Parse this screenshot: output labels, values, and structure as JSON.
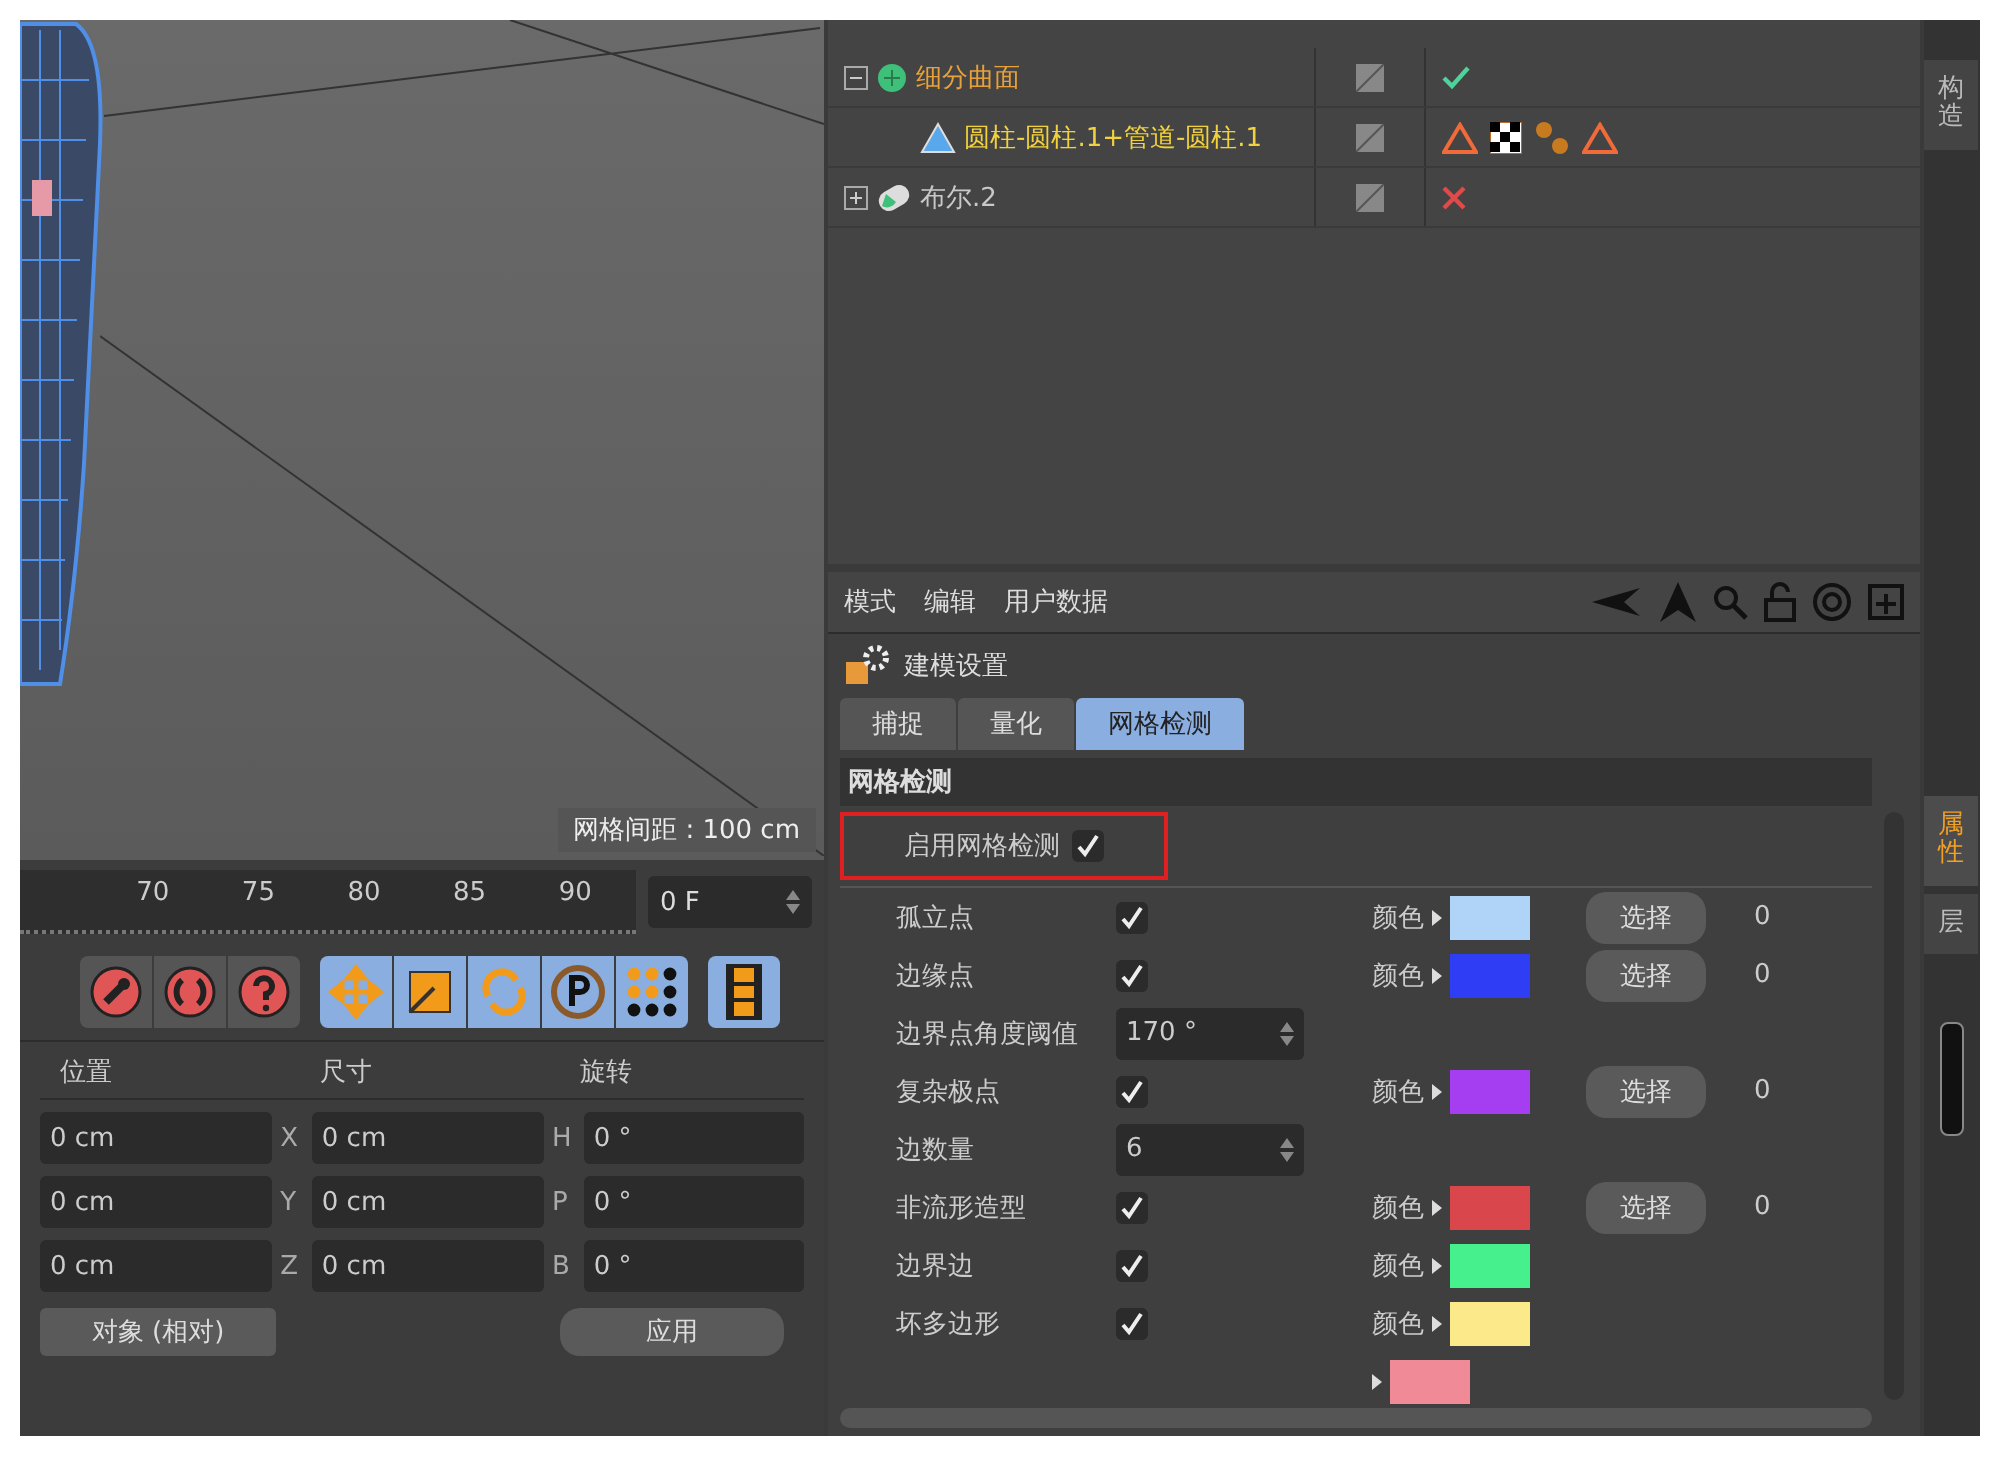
{
  "viewport": {
    "grid_label": "网格间距 : 100 cm"
  },
  "timeline": {
    "ticks": [
      "70",
      "75",
      "80",
      "85",
      "90"
    ],
    "frame": "0 F"
  },
  "toolbar": {
    "groups": [
      {
        "kind": "red",
        "tools": [
          {
            "kind": "wrench"
          },
          {
            "kind": "cycle"
          },
          {
            "kind": "help"
          }
        ]
      },
      {
        "kind": "blue",
        "tools": [
          {
            "kind": "move"
          },
          {
            "kind": "scale"
          },
          {
            "kind": "rotate"
          },
          {
            "kind": "p"
          },
          {
            "kind": "dots"
          }
        ]
      },
      {
        "kind": "blue",
        "tools": [
          {
            "kind": "film"
          }
        ]
      }
    ]
  },
  "coordinates": {
    "headers": [
      "位置",
      "尺寸",
      "旋转"
    ],
    "rows": [
      {
        "position": "0 cm",
        "axis": "X",
        "size": "0 cm",
        "rot_axis": "H",
        "rotation": "0 °"
      },
      {
        "position": "0 cm",
        "axis": "Y",
        "size": "0 cm",
        "rot_axis": "P",
        "rotation": "0 °"
      },
      {
        "position": "0 cm",
        "axis": "Z",
        "size": "0 cm",
        "rot_axis": "B",
        "rotation": "0 °"
      }
    ],
    "mode": "对象 (相对)",
    "apply": "应用"
  },
  "objects": [
    {
      "name": "细分曲面",
      "color": "#e8a13a",
      "expanded": true,
      "kind": "subdivision",
      "tags": [
        {
          "kind": "check"
        }
      ],
      "children": [
        {
          "name": "圆柱-圆柱.1+管道-圆柱.1",
          "color": "#f2d23c",
          "kind": "polygon",
          "tags": [
            {
              "kind": "warning"
            },
            {
              "kind": "checker"
            },
            {
              "kind": "spheres"
            },
            {
              "kind": "warning"
            }
          ]
        }
      ]
    },
    {
      "name": "布尔.2",
      "color": "#c8c8c8",
      "expanded": false,
      "kind": "boolean",
      "tags": [
        {
          "kind": "cross"
        }
      ]
    }
  ],
  "side_tabs_top": [
    {
      "label": "构造",
      "selected": false
    }
  ],
  "side_tabs_bottom": [
    {
      "label": "属性",
      "selected": true
    },
    {
      "label": "层",
      "selected": false
    }
  ],
  "attributes": {
    "menu": [
      "模式",
      "编辑",
      "用户数据"
    ],
    "title": "建模设置",
    "tabs": [
      {
        "label": "捕捉",
        "selected": false
      },
      {
        "label": "量化",
        "selected": false
      },
      {
        "label": "网格检测",
        "selected": true
      }
    ],
    "section": "网格检测",
    "enable": {
      "label": "启用网格检测",
      "checked": true,
      "highlighted": true
    },
    "rows": [
      {
        "kind": "check",
        "label": "孤立点",
        "checked": true,
        "color_label": "颜色",
        "color": "#b0d4f8",
        "button": "选择",
        "count": "0"
      },
      {
        "kind": "check",
        "label": "边缘点",
        "checked": true,
        "color_label": "颜色",
        "color": "#2f3ef5",
        "button": "选择",
        "count": "0"
      },
      {
        "kind": "number",
        "label": "边界点角度阈值",
        "value": "170 °"
      },
      {
        "kind": "check",
        "label": "复杂极点",
        "checked": true,
        "color_label": "颜色",
        "color": "#a53df0",
        "button": "选择",
        "count": "0"
      },
      {
        "kind": "number",
        "label": "边数量",
        "value": "6"
      },
      {
        "kind": "check",
        "label": "非流形造型",
        "checked": true,
        "color_label": "颜色",
        "color": "#d9474d",
        "button": "选择",
        "count": "0"
      },
      {
        "kind": "check",
        "label": "边界边",
        "checked": true,
        "color_label": "颜色",
        "color": "#46f08c"
      },
      {
        "kind": "check",
        "label": "坏多边形",
        "checked": true,
        "color_label": "颜色",
        "color": "#fbe98a"
      },
      {
        "kind": "color",
        "color": "#f08a96"
      }
    ]
  }
}
